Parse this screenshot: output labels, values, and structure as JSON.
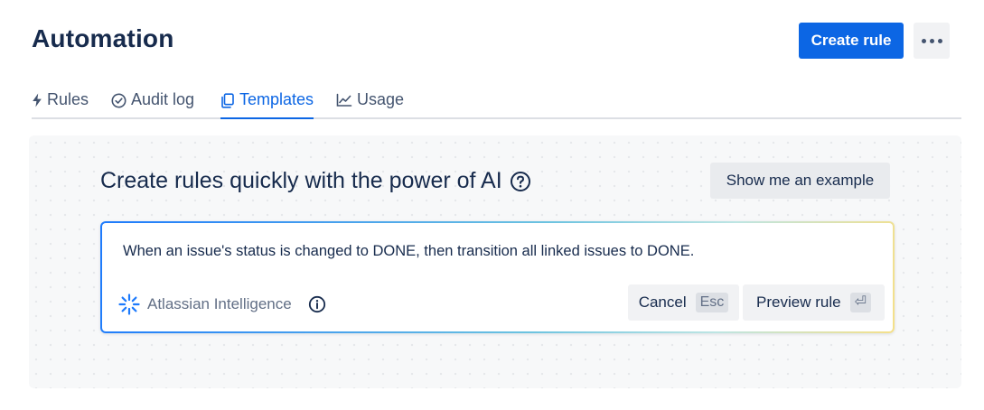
{
  "header": {
    "title": "Automation",
    "create_label": "Create rule",
    "more_icon": "more-horizontal-icon"
  },
  "tabs": [
    {
      "label": "Rules",
      "icon": "lightning-icon",
      "active": false
    },
    {
      "label": "Audit log",
      "icon": "check-circle-icon",
      "active": false
    },
    {
      "label": "Templates",
      "icon": "copy-icon",
      "active": true
    },
    {
      "label": "Usage",
      "icon": "line-chart-icon",
      "active": false
    }
  ],
  "ai_panel": {
    "headline": "Create rules quickly with the power of AI",
    "help_icon": "question-circle-icon",
    "example_label": "Show me an example",
    "prompt_text": "When an issue's status is changed to DONE, then transition all linked issues to DONE.",
    "ai_label": "Atlassian Intelligence",
    "cancel_label": "Cancel",
    "cancel_shortcut": "Esc",
    "preview_label": "Preview rule",
    "preview_shortcut": "⏎"
  },
  "colors": {
    "primary": "#0c66e4",
    "text": "#172b4d",
    "subtle_text": "#626f86"
  }
}
